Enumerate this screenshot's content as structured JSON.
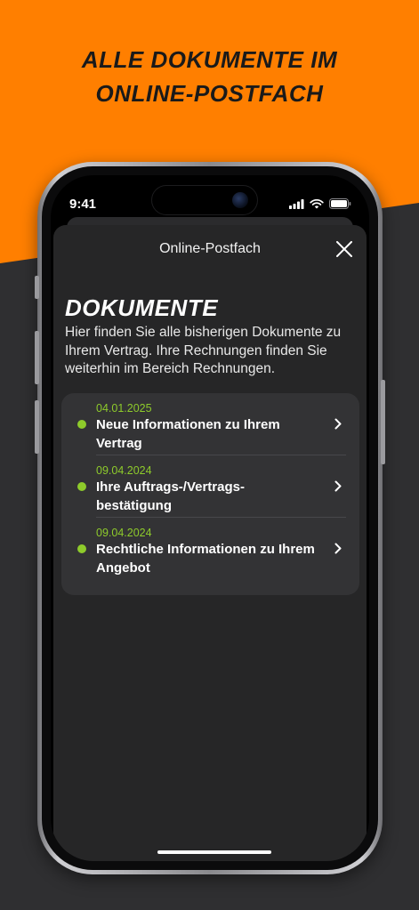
{
  "promo": {
    "headline_line1": "ALLE DOKUMENTE IM",
    "headline_line2": "ONLINE-POSTFACH"
  },
  "colors": {
    "brand_orange": "#ff7f00",
    "background_dark": "#2f2f31",
    "status_green": "#8ecb2b"
  },
  "status_bar": {
    "time": "9:41",
    "icons": [
      "signal-icon",
      "wifi-icon",
      "battery-icon"
    ]
  },
  "sheet": {
    "title": "Online-Postfach",
    "close_icon": "close-icon"
  },
  "documents_page": {
    "heading": "DOKUMENTE",
    "intro": "Hier finden Sie alle bisherigen Dokumente zu Ihrem Vertrag. Ihre Rechnungen finden Sie weiterhin im Bereich Rechnungen.",
    "items": [
      {
        "date": "04.01.2025",
        "title": "Neue Informationen zu Ihrem Vertrag",
        "status": "unread"
      },
      {
        "date": "09.04.2024",
        "title": "Ihre Auftrags-/Vertrags-bestätigung",
        "status": "unread"
      },
      {
        "date": "09.04.2024",
        "title": "Rechtliche Informationen zu Ihrem Angebot",
        "status": "unread"
      }
    ]
  }
}
